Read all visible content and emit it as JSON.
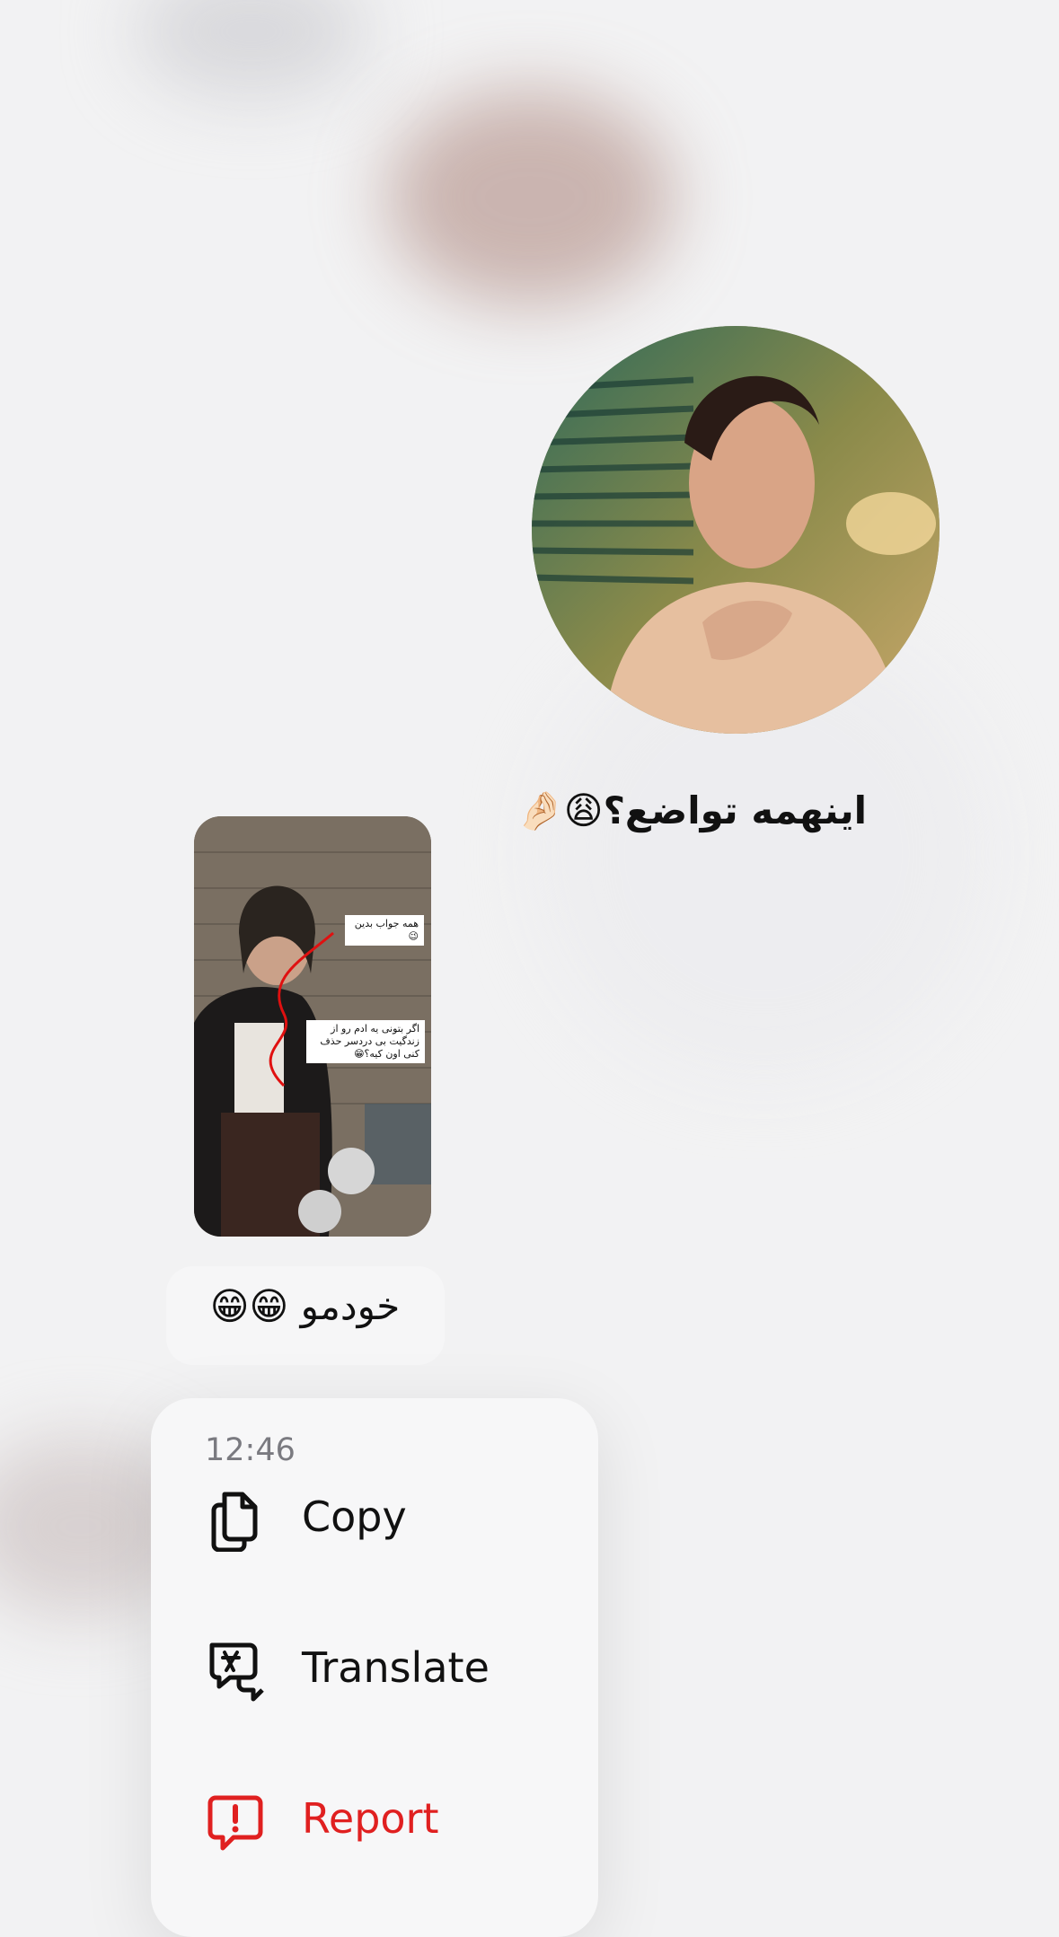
{
  "messages": {
    "round_video": {
      "caption": "اینهمه تواضع؟😩🤌🏻"
    },
    "story": {
      "sticker_top": "همه جواب بدین😉",
      "sticker_bottom": "اگر بتونی یه ادم رو از زندگیت بی دردسر حذف کنی اون کیه؟😁"
    },
    "text_bubble": {
      "text": "خودمو 😁😁"
    }
  },
  "context_menu": {
    "time": "12:46",
    "items": [
      {
        "label": "Copy",
        "icon": "copy-icon"
      },
      {
        "label": "Translate",
        "icon": "translate-icon"
      },
      {
        "label": "Report",
        "icon": "report-icon"
      }
    ]
  },
  "colors": {
    "destructive": "#e02020",
    "menu_background": "#f7f7f8",
    "secondary_text": "#7a7a80"
  }
}
